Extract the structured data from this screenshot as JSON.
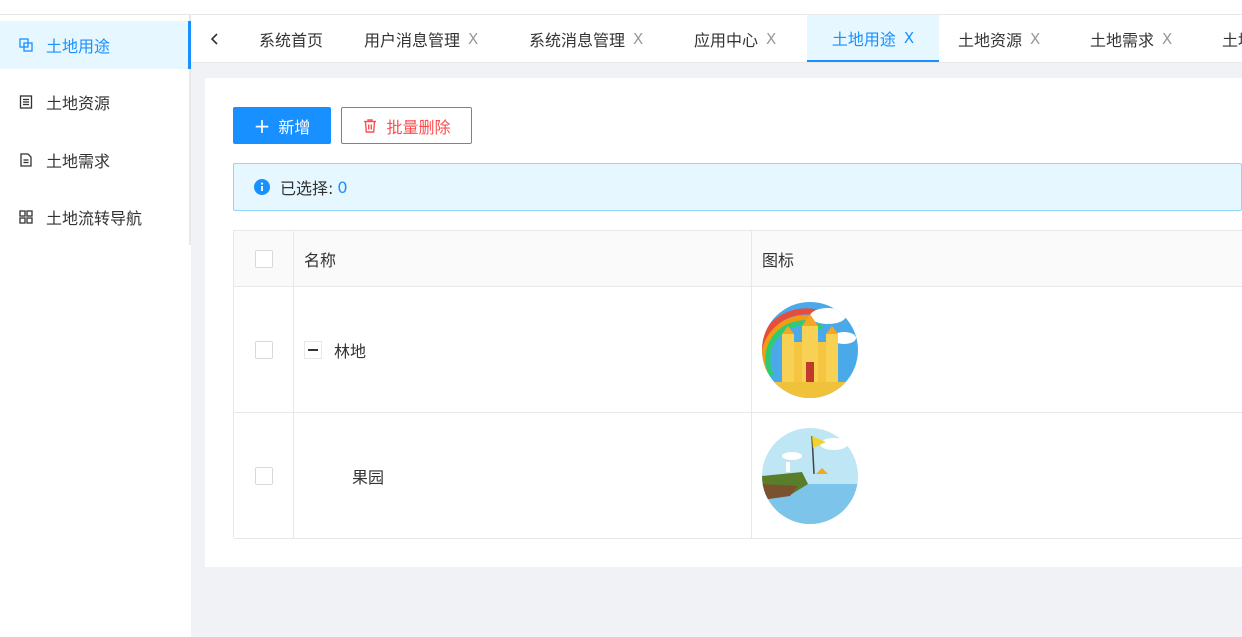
{
  "sidebar": {
    "items": [
      {
        "label": "土地用途",
        "icon": "copy-icon",
        "active": true
      },
      {
        "label": "土地资源",
        "icon": "list-icon",
        "active": false
      },
      {
        "label": "土地需求",
        "icon": "file-icon",
        "active": false
      },
      {
        "label": "土地流转导航",
        "icon": "grid-icon",
        "active": false
      }
    ]
  },
  "tabs": {
    "prev_icon": "chevron-left-icon",
    "close_label": "X",
    "items": [
      {
        "label": "系统首页",
        "closable": false
      },
      {
        "label": "用户消息管理",
        "closable": true
      },
      {
        "label": "系统消息管理",
        "closable": true
      },
      {
        "label": "应用中心",
        "closable": true
      },
      {
        "label": "土地用途",
        "closable": true,
        "active": true
      },
      {
        "label": "土地资源",
        "closable": true
      },
      {
        "label": "土地需求",
        "closable": true
      },
      {
        "label": "土地",
        "closable": false
      }
    ]
  },
  "toolbar": {
    "add_label": "新增",
    "add_icon": "+",
    "batch_delete_label": "批量删除"
  },
  "alert": {
    "prefix": "已选择:",
    "count": "0"
  },
  "table": {
    "columns": [
      "名称",
      "图标"
    ],
    "rows": [
      {
        "name": "林地",
        "expanded": true,
        "level": 0,
        "icon": "castle-rainbow-image"
      },
      {
        "name": "果园",
        "expanded": false,
        "level": 1,
        "icon": "island-flag-image"
      }
    ]
  },
  "colors": {
    "primary": "#1890ff",
    "danger": "#ff4d4f",
    "alert_bg": "#e6f7ff",
    "alert_border": "#91d5ff"
  }
}
